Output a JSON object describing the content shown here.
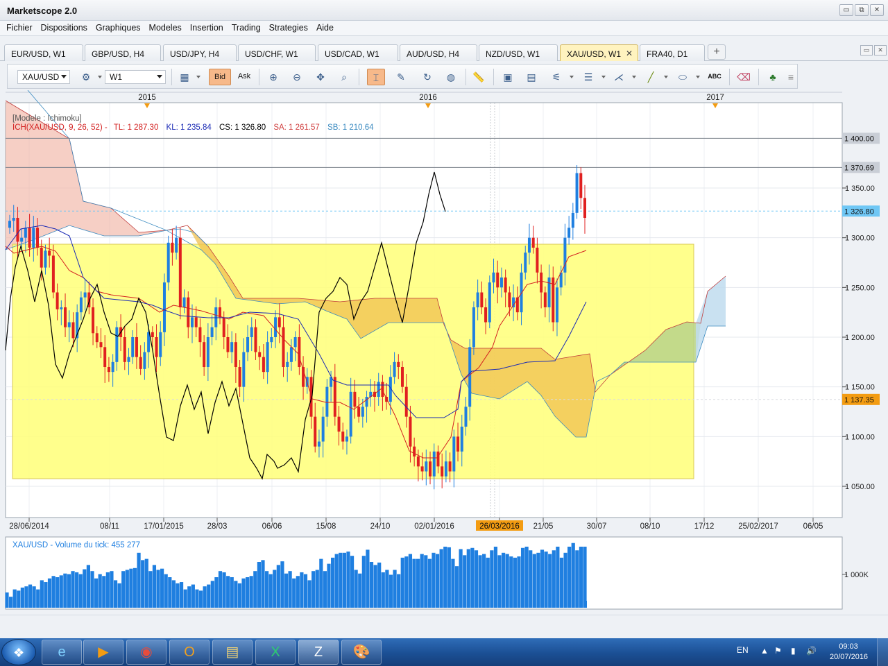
{
  "window": {
    "title": "Marketscope 2.0",
    "controls": [
      "▭",
      "⧉",
      "✕"
    ]
  },
  "menu": [
    "Fichier",
    "Dispositions",
    "Graphiques",
    "Modeles",
    "Insertion",
    "Trading",
    "Strategies",
    "Aide"
  ],
  "tabs": [
    {
      "label": "EUR/USD, W1",
      "active": false
    },
    {
      "label": "GBP/USD, H4",
      "active": false
    },
    {
      "label": "USD/JPY, H4",
      "active": false
    },
    {
      "label": "USD/CHF, W1",
      "active": false
    },
    {
      "label": "USD/CAD, W1",
      "active": false
    },
    {
      "label": "AUD/USD, H4",
      "active": false
    },
    {
      "label": "NZD/USD, W1",
      "active": false
    },
    {
      "label": "XAU/USD, W1",
      "active": true
    },
    {
      "label": "FRA40, D1",
      "active": false
    }
  ],
  "tab_close": "✕",
  "tab_add": "+",
  "tab_controls": [
    "▭",
    "✕"
  ],
  "toolbar": {
    "symbol": "XAU/USD",
    "timeframe": "W1",
    "bid_label": "Bid",
    "ask_label": "Ask",
    "abc_label": "ABC"
  },
  "chart": {
    "header": "[Modele : Ichimoku]",
    "indicator": {
      "name": "ICH(XAU/USD, 9, 26, 52) -",
      "tl": "TL: 1 287.30",
      "kl": "KL: 1 235.84",
      "cs": "CS: 1 326.80",
      "sa": "SA: 1 261.57",
      "sb": "SB: 1 210.64"
    },
    "top_years": [
      "2015",
      "2016",
      "2017"
    ],
    "y_ticks": [
      "1 350.00",
      "1 300.00",
      "1 250.00",
      "1 200.00",
      "1 150.00",
      "1 100.00",
      "1 050.00"
    ],
    "price_tags": [
      {
        "label": "1 400.00",
        "color": "#c9ced6"
      },
      {
        "label": "1 370.69",
        "color": "#c9ced6"
      },
      {
        "label": "1 326.80",
        "color": "#6fc7f5"
      },
      {
        "label": "1 137.35",
        "color": "#f39c12"
      }
    ],
    "x_ticks": [
      "28/06/2014",
      "08/11",
      "17/01/2015",
      "28/03",
      "06/06",
      "15/08",
      "24/10",
      "02/01/2016",
      "26/03/2016",
      "21/05",
      "30/07",
      "08/10",
      "17/12",
      "25/02/2017",
      "06/05"
    ],
    "highlight_date": "26/03/2016",
    "colors": {
      "bull": "#1f7fe0",
      "bear": "#e02020",
      "tenkan": "#d32020",
      "kijun": "#1a2ab5",
      "chikou": "#000000",
      "rect": "#ffff78",
      "cloud_bull": "#f0c050",
      "cloud_bear": "#c0dcef"
    }
  },
  "volume": {
    "label": "XAU/USD - Volume du tick: 455 277",
    "y_tick": "1 000K",
    "bar_color": "#1f7fe0"
  },
  "chart_data": {
    "type": "candlestick",
    "symbol": "XAU/USD",
    "timeframe": "W1",
    "indicators": {
      "tenkan": 1287.3,
      "kijun": 1235.84,
      "chikou": 1326.8,
      "senkou_a": 1261.57,
      "senkou_b": 1210.64
    },
    "last_price": 1326.8,
    "ylim": [
      1035,
      1445
    ],
    "volume_last": 455277
  },
  "taskbar": {
    "apps": [
      "e",
      "▶",
      "◉",
      "O",
      "▤",
      "X",
      "Z",
      "🎨"
    ],
    "lang": "EN",
    "tray_icons": [
      "▲",
      "⚑",
      "▮",
      "🔊"
    ],
    "time": "09:03",
    "date": "20/07/2016"
  }
}
